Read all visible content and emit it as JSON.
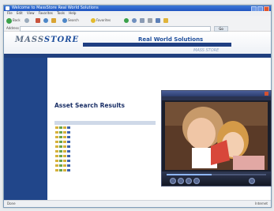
{
  "browser": {
    "title": "Welcome to MassStore Real World Solutions",
    "menu": [
      "File",
      "Edit",
      "View",
      "Favorites",
      "Tools",
      "Help"
    ],
    "toolbar": [
      "Back",
      "Search",
      "Favorites"
    ],
    "address_label": "Address",
    "address_value": "",
    "go_label": "Go",
    "status_left": "Done",
    "status_right": "Internet"
  },
  "site": {
    "logo_left": "MASS",
    "logo_right": "STORE",
    "tagline": "Real World Solutions",
    "second_logo": "MASS STORE"
  },
  "results": {
    "heading": "Asset Search Results"
  },
  "colors": {
    "nav_blue": "#21468a",
    "title_blue": "#1a2f66",
    "accent_blue": "#1e4e9c"
  }
}
